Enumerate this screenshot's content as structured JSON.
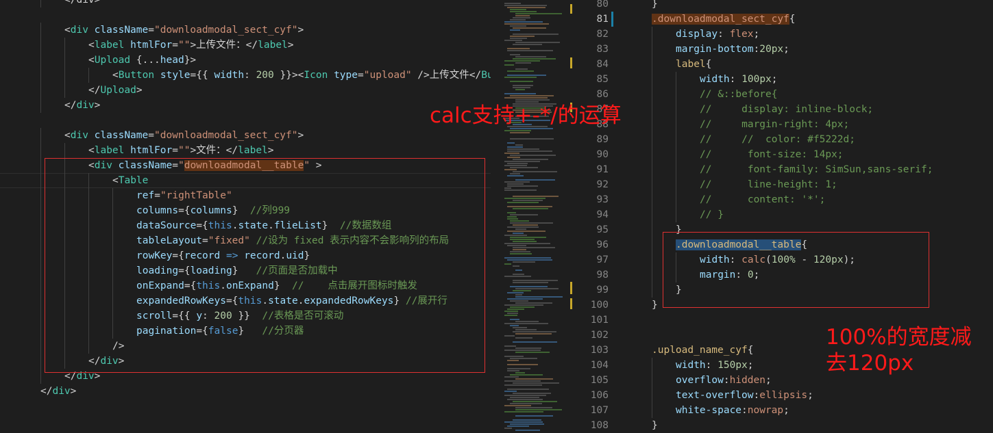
{
  "left": {
    "lines": [
      {
        "indent": 2,
        "tokens": [
          [
            "p",
            "</div>"
          ]
        ]
      },
      {
        "indent": 0,
        "tokens": []
      },
      {
        "indent": 2,
        "tokens": [
          [
            "p",
            "<"
          ],
          [
            "t",
            "div"
          ],
          [
            "p",
            " "
          ],
          [
            "a",
            "className"
          ],
          [
            "p",
            "="
          ],
          [
            "s",
            "\"downloadmodal_sect_cyf\""
          ],
          [
            "p",
            ">"
          ]
        ]
      },
      {
        "indent": 3,
        "tokens": [
          [
            "p",
            "<"
          ],
          [
            "t",
            "label"
          ],
          [
            "p",
            " "
          ],
          [
            "a",
            "htmlFor"
          ],
          [
            "p",
            "="
          ],
          [
            "s",
            "\"\""
          ],
          [
            "p",
            ">上传文件：</"
          ],
          [
            "t",
            "label"
          ],
          [
            "p",
            ">"
          ]
        ]
      },
      {
        "indent": 3,
        "tokens": [
          [
            "p",
            "<"
          ],
          [
            "t",
            "Upload"
          ],
          [
            "p",
            " {..."
          ],
          [
            "a",
            "head"
          ],
          [
            "p",
            "}>"
          ]
        ]
      },
      {
        "indent": 4,
        "tokens": [
          [
            "p",
            "<"
          ],
          [
            "t",
            "Button"
          ],
          [
            "p",
            " "
          ],
          [
            "a",
            "style"
          ],
          [
            "p",
            "={{ "
          ],
          [
            "a",
            "width"
          ],
          [
            "p",
            ": "
          ],
          [
            "n",
            "200"
          ],
          [
            "p",
            " }}><"
          ],
          [
            "t",
            "Icon"
          ],
          [
            "p",
            " "
          ],
          [
            "a",
            "type"
          ],
          [
            "p",
            "="
          ],
          [
            "s",
            "\"upload\""
          ],
          [
            "p",
            " />上传文件</"
          ],
          [
            "t",
            "Butto"
          ]
        ]
      },
      {
        "indent": 3,
        "tokens": [
          [
            "p",
            "</"
          ],
          [
            "t",
            "Upload"
          ],
          [
            "p",
            ">"
          ]
        ]
      },
      {
        "indent": 2,
        "tokens": [
          [
            "p",
            "</"
          ],
          [
            "t",
            "div"
          ],
          [
            "p",
            ">"
          ]
        ]
      },
      {
        "indent": 0,
        "tokens": []
      },
      {
        "indent": 2,
        "tokens": [
          [
            "p",
            "<"
          ],
          [
            "t",
            "div"
          ],
          [
            "p",
            " "
          ],
          [
            "a",
            "className"
          ],
          [
            "p",
            "="
          ],
          [
            "s",
            "\"downloadmodal_sect_cyf\""
          ],
          [
            "p",
            ">"
          ]
        ]
      },
      {
        "indent": 3,
        "tokens": [
          [
            "p",
            "<"
          ],
          [
            "t",
            "label"
          ],
          [
            "p",
            " "
          ],
          [
            "a",
            "htmlFor"
          ],
          [
            "p",
            "="
          ],
          [
            "s",
            "\"\""
          ],
          [
            "p",
            ">文件：</"
          ],
          [
            "t",
            "label"
          ],
          [
            "p",
            ">"
          ]
        ]
      },
      {
        "indent": 3,
        "tokens": [
          [
            "p",
            "<"
          ],
          [
            "t",
            "div"
          ],
          [
            "p",
            " "
          ],
          [
            "a",
            "className"
          ],
          [
            "p",
            "="
          ],
          [
            "s",
            "\""
          ],
          [
            "so",
            "downloadmodal__table"
          ],
          [
            "s",
            "\""
          ],
          [
            "p",
            " >"
          ]
        ]
      },
      {
        "indent": 4,
        "tokens": [
          [
            "p",
            "<"
          ],
          [
            "t",
            "Table"
          ]
        ]
      },
      {
        "indent": 5,
        "tokens": [
          [
            "a",
            "ref"
          ],
          [
            "p",
            "="
          ],
          [
            "s",
            "\"rightTable\""
          ]
        ]
      },
      {
        "indent": 5,
        "tokens": [
          [
            "a",
            "columns"
          ],
          [
            "p",
            "={"
          ],
          [
            "a",
            "columns"
          ],
          [
            "p",
            "}  "
          ],
          [
            "c",
            "//列999"
          ]
        ]
      },
      {
        "indent": 5,
        "tokens": [
          [
            "a",
            "dataSource"
          ],
          [
            "p",
            "={"
          ],
          [
            "k",
            "this"
          ],
          [
            "p",
            "."
          ],
          [
            "a",
            "state"
          ],
          [
            "p",
            "."
          ],
          [
            "a",
            "flieList"
          ],
          [
            "p",
            "}  "
          ],
          [
            "c",
            "//数据数组"
          ]
        ]
      },
      {
        "indent": 5,
        "tokens": [
          [
            "a",
            "tableLayout"
          ],
          [
            "p",
            "="
          ],
          [
            "s",
            "\"fixed\""
          ],
          [
            "p",
            " "
          ],
          [
            "c",
            "//设为 fixed 表示内容不会影响列的布局"
          ]
        ]
      },
      {
        "indent": 5,
        "tokens": [
          [
            "a",
            "rowKey"
          ],
          [
            "p",
            "={"
          ],
          [
            "a",
            "record"
          ],
          [
            "p",
            " "
          ],
          [
            "k",
            "=>"
          ],
          [
            "p",
            " "
          ],
          [
            "a",
            "record"
          ],
          [
            "p",
            "."
          ],
          [
            "a",
            "uid"
          ],
          [
            "p",
            "}"
          ]
        ]
      },
      {
        "indent": 5,
        "tokens": [
          [
            "a",
            "loading"
          ],
          [
            "p",
            "={"
          ],
          [
            "a",
            "loading"
          ],
          [
            "p",
            "}   "
          ],
          [
            "c",
            "//页面是否加载中"
          ]
        ]
      },
      {
        "indent": 5,
        "tokens": [
          [
            "a",
            "onExpand"
          ],
          [
            "p",
            "={"
          ],
          [
            "k",
            "this"
          ],
          [
            "p",
            "."
          ],
          [
            "a",
            "onExpand"
          ],
          [
            "p",
            "}  "
          ],
          [
            "c",
            "//    点击展开图标时触发"
          ]
        ]
      },
      {
        "indent": 5,
        "tokens": [
          [
            "a",
            "expandedRowKeys"
          ],
          [
            "p",
            "={"
          ],
          [
            "k",
            "this"
          ],
          [
            "p",
            "."
          ],
          [
            "a",
            "state"
          ],
          [
            "p",
            "."
          ],
          [
            "a",
            "expandedRowKeys"
          ],
          [
            "p",
            "} "
          ],
          [
            "c",
            "//展开行"
          ]
        ]
      },
      {
        "indent": 5,
        "tokens": [
          [
            "a",
            "scroll"
          ],
          [
            "p",
            "={{ "
          ],
          [
            "a",
            "y"
          ],
          [
            "p",
            ": "
          ],
          [
            "n",
            "200"
          ],
          [
            "p",
            " }}  "
          ],
          [
            "c",
            "//表格是否可滚动"
          ]
        ]
      },
      {
        "indent": 5,
        "tokens": [
          [
            "a",
            "pagination"
          ],
          [
            "p",
            "={"
          ],
          [
            "k",
            "false"
          ],
          [
            "p",
            "}   "
          ],
          [
            "c",
            "//分页器"
          ]
        ]
      },
      {
        "indent": 4,
        "tokens": [
          [
            "p",
            "/>"
          ]
        ]
      },
      {
        "indent": 3,
        "tokens": [
          [
            "p",
            "</"
          ],
          [
            "t",
            "div"
          ],
          [
            "p",
            ">"
          ]
        ]
      },
      {
        "indent": 2,
        "tokens": [
          [
            "p",
            "</"
          ],
          [
            "t",
            "div"
          ],
          [
            "p",
            ">"
          ]
        ]
      },
      {
        "indent": 1,
        "tokens": [
          [
            "p",
            "</"
          ],
          [
            "t",
            "div"
          ],
          [
            "p",
            ">"
          ]
        ]
      }
    ]
  },
  "right": {
    "line_numbers": [
      "80",
      "81",
      "82",
      "83",
      "84",
      "85",
      "86",
      "87",
      "88",
      "89",
      "90",
      "91",
      "92",
      "93",
      "94",
      "95",
      "96",
      "97",
      "98",
      "99",
      "100",
      "101",
      "102",
      "103",
      "104",
      "105",
      "106",
      "107",
      "108"
    ],
    "lines": [
      {
        "indent": 1,
        "tokens": [
          [
            "p",
            "}"
          ]
        ]
      },
      {
        "indent": 1,
        "tokens": [
          [
            "so",
            "."
          ],
          [
            "so",
            "downloadmodal_sect_cyf"
          ],
          [
            "p",
            "{"
          ]
        ]
      },
      {
        "indent": 2,
        "tokens": [
          [
            "a",
            "display"
          ],
          [
            "p",
            ": "
          ],
          [
            "s",
            "flex"
          ],
          [
            "p",
            ";"
          ]
        ]
      },
      {
        "indent": 2,
        "tokens": [
          [
            "a",
            "margin-bottom"
          ],
          [
            "p",
            ":"
          ],
          [
            "n",
            "20px"
          ],
          [
            "p",
            ";"
          ]
        ]
      },
      {
        "indent": 2,
        "tokens": [
          [
            "sel",
            "label"
          ],
          [
            "p",
            "{"
          ]
        ]
      },
      {
        "indent": 3,
        "tokens": [
          [
            "a",
            "width"
          ],
          [
            "p",
            ": "
          ],
          [
            "n",
            "100px"
          ],
          [
            "p",
            ";"
          ]
        ]
      },
      {
        "indent": 3,
        "tokens": [
          [
            "c",
            "// &::before{"
          ]
        ]
      },
      {
        "indent": 3,
        "tokens": [
          [
            "c",
            "//     display: inline-block;"
          ]
        ]
      },
      {
        "indent": 3,
        "tokens": [
          [
            "c",
            "//     margin-right: 4px;"
          ]
        ]
      },
      {
        "indent": 3,
        "tokens": [
          [
            "c",
            "//     //  color: #f5222d;"
          ]
        ]
      },
      {
        "indent": 3,
        "tokens": [
          [
            "c",
            "//      font-size: 14px;"
          ]
        ]
      },
      {
        "indent": 3,
        "tokens": [
          [
            "c",
            "//      font-family: SimSun,sans-serif;"
          ]
        ]
      },
      {
        "indent": 3,
        "tokens": [
          [
            "c",
            "//      line-height: 1;"
          ]
        ]
      },
      {
        "indent": 3,
        "tokens": [
          [
            "c",
            "//      content: '*';"
          ]
        ]
      },
      {
        "indent": 3,
        "tokens": [
          [
            "c",
            "// }"
          ]
        ]
      },
      {
        "indent": 2,
        "tokens": [
          [
            "p",
            "}"
          ]
        ]
      },
      {
        "indent": 2,
        "tokens": [
          [
            "sb",
            ".downloadmodal__table"
          ],
          [
            "p",
            "{"
          ]
        ]
      },
      {
        "indent": 3,
        "tokens": [
          [
            "a",
            "width"
          ],
          [
            "p",
            ": "
          ],
          [
            "s",
            "calc"
          ],
          [
            "p",
            "("
          ],
          [
            "n",
            "100%"
          ],
          [
            "p",
            " - "
          ],
          [
            "n",
            "120px"
          ],
          [
            "p",
            ");"
          ]
        ]
      },
      {
        "indent": 3,
        "tokens": [
          [
            "a",
            "margin"
          ],
          [
            "p",
            ": "
          ],
          [
            "n",
            "0"
          ],
          [
            "p",
            ";"
          ]
        ]
      },
      {
        "indent": 2,
        "tokens": [
          [
            "p",
            "}"
          ]
        ]
      },
      {
        "indent": 1,
        "tokens": [
          [
            "p",
            "}"
          ]
        ]
      },
      {
        "indent": 0,
        "tokens": []
      },
      {
        "indent": 0,
        "tokens": []
      },
      {
        "indent": 1,
        "tokens": [
          [
            "sel",
            ".upload_name_cyf"
          ],
          [
            "p",
            "{"
          ]
        ]
      },
      {
        "indent": 2,
        "tokens": [
          [
            "a",
            "width"
          ],
          [
            "p",
            ": "
          ],
          [
            "n",
            "150px"
          ],
          [
            "p",
            ";"
          ]
        ]
      },
      {
        "indent": 2,
        "tokens": [
          [
            "a",
            "overflow"
          ],
          [
            "p",
            ":"
          ],
          [
            "s",
            "hidden"
          ],
          [
            "p",
            ";"
          ]
        ]
      },
      {
        "indent": 2,
        "tokens": [
          [
            "a",
            "text-overflow"
          ],
          [
            "p",
            ":"
          ],
          [
            "s",
            "ellipsis"
          ],
          [
            "p",
            ";"
          ]
        ]
      },
      {
        "indent": 2,
        "tokens": [
          [
            "a",
            "white-space"
          ],
          [
            "p",
            ":"
          ],
          [
            "s",
            "nowrap"
          ],
          [
            "p",
            ";"
          ]
        ]
      },
      {
        "indent": 1,
        "tokens": [
          [
            "p",
            "}"
          ]
        ]
      }
    ]
  },
  "annotations": {
    "calc_note": "calc支持+-*/的运算",
    "width_note": "100%的宽度减\n去120px"
  }
}
